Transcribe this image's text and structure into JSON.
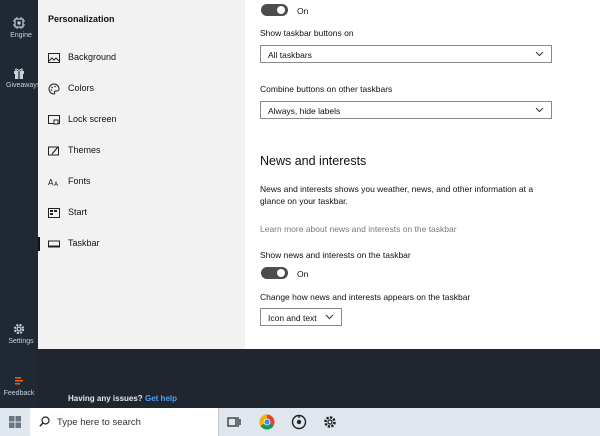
{
  "leftbar": {
    "items": [
      {
        "label": "Engine"
      },
      {
        "label": "Giveaways"
      },
      {
        "label": "Settings"
      },
      {
        "label": "Feedback"
      }
    ]
  },
  "nav": {
    "title": "Personalization",
    "items": [
      {
        "label": "Background"
      },
      {
        "label": "Colors"
      },
      {
        "label": "Lock screen"
      },
      {
        "label": "Themes"
      },
      {
        "label": "Fonts"
      },
      {
        "label": "Start"
      },
      {
        "label": "Taskbar"
      }
    ]
  },
  "content": {
    "toggle1_state": "On",
    "show_buttons_label": "Show taskbar buttons on",
    "show_buttons_value": "All taskbars",
    "combine_label": "Combine buttons on other taskbars",
    "combine_value": "Always, hide labels",
    "news_title": "News and interests",
    "news_desc": "News and interests shows you weather, news, and other information at a glance on your taskbar.",
    "learn_more": "Learn more about news and interests on the taskbar",
    "show_news_label": "Show news and interests on the taskbar",
    "toggle2_state": "On",
    "change_label": "Change how news and interests appears on the taskbar",
    "change_value": "Icon and text"
  },
  "banner": {
    "issues_text": "Having any issues?",
    "help_link": "Get help"
  },
  "taskbar": {
    "search_placeholder": "Type here to search"
  },
  "colors": {
    "accent": "#4ea0f5",
    "feedback": "#e8590c",
    "toggle": "#4c4c4c"
  }
}
